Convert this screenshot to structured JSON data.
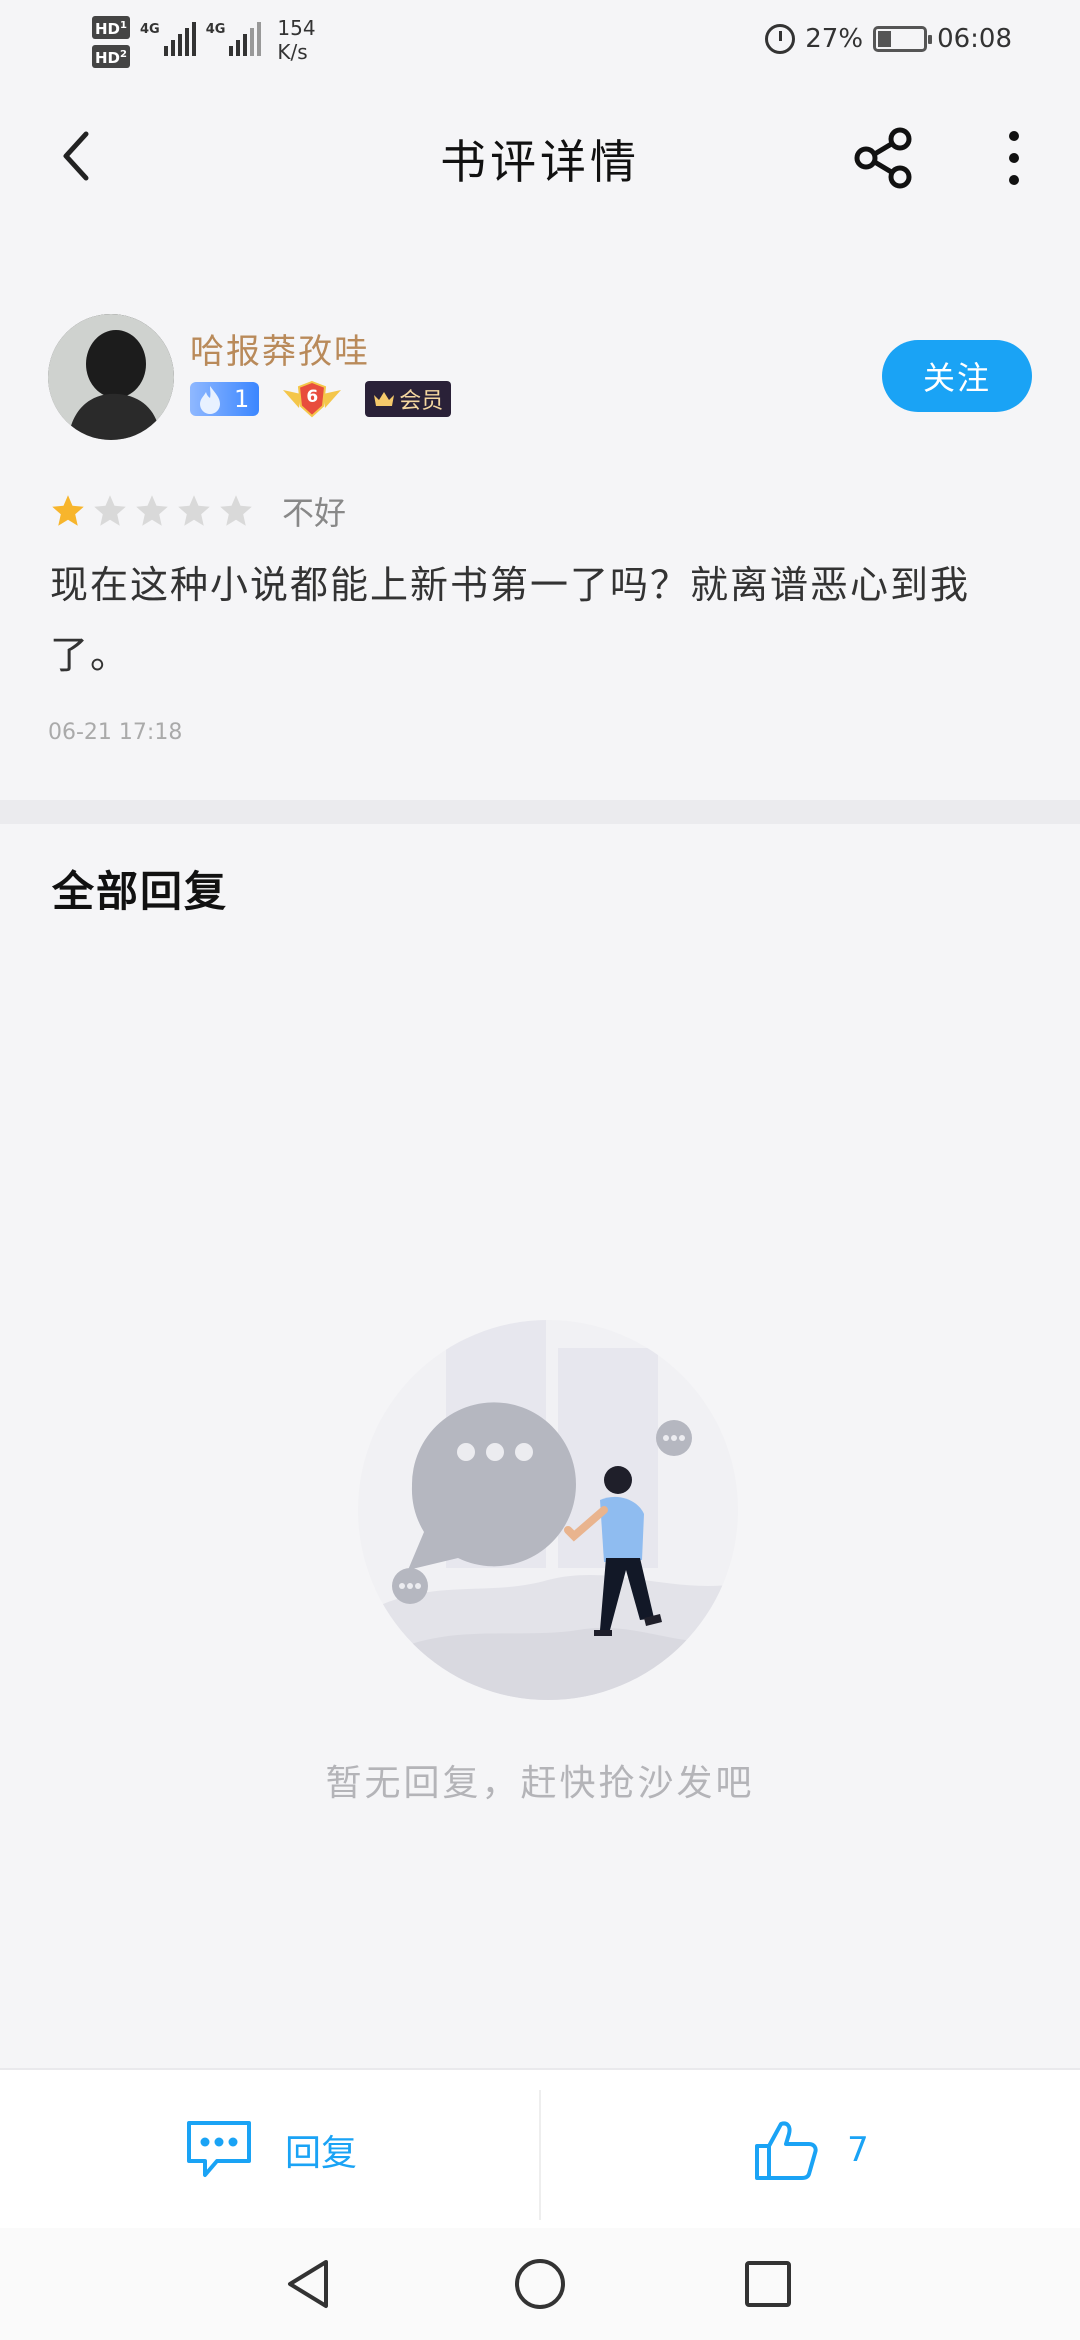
{
  "status_bar": {
    "sim1": "HD",
    "sim2": "HD",
    "net1": "4G",
    "net2": "4G",
    "speed_value": "154",
    "speed_unit": "K/s",
    "battery": "27%",
    "time": "06:08"
  },
  "nav": {
    "title": "书评详情",
    "back_icon": "chevron-left-icon",
    "share_icon": "share-icon",
    "more_icon": "more-vertical-icon"
  },
  "review": {
    "username": "哈报莽孜哇",
    "fan_level": "1",
    "medal_level": "6",
    "vip_label": "会员",
    "follow_label": "关注",
    "rating": 1,
    "rating_max": 5,
    "rating_label": "不好",
    "text": "现在这种小说都能上新书第一了吗？就离谱恶心到我了。",
    "time": "06-21 17:18"
  },
  "replies": {
    "title": "全部回复",
    "empty_text": "暂无回复，赶快抢沙发吧"
  },
  "actions": {
    "reply_label": "回复",
    "like_count": "7"
  },
  "colors": {
    "accent": "#1aa3f5",
    "username": "#b98a5a",
    "star_active": "#f7b52c",
    "star_inactive": "#d9d9d9"
  }
}
